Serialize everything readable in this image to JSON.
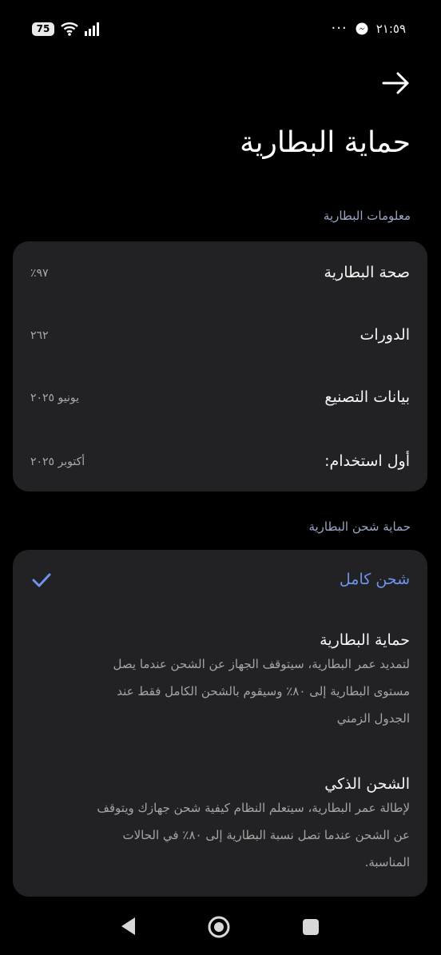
{
  "status_bar": {
    "battery": "75",
    "time": "٢١:٥٩"
  },
  "header": {
    "title": "حماية البطارية"
  },
  "battery_info": {
    "section_label": "معلومات البطارية",
    "rows": [
      {
        "label": "صحة البطارية",
        "value": "٩٧٪"
      },
      {
        "label": "الدورات",
        "value": "٢٦٢"
      },
      {
        "label": "بيانات التصنيع",
        "value": "يونيو ٢٠٢٥"
      },
      {
        "label": "أول استخدام:",
        "value": "أكتوبر ٢٠٢٥"
      }
    ]
  },
  "charging_protection": {
    "section_label": "حماية شحن البطارية",
    "options": [
      {
        "title": "شحن كامل",
        "selected": true
      },
      {
        "title": "حماية البطارية",
        "lines": [
          "لتمديد عمر البطارية، سيتوقف الجهاز عن الشحن عندما يصل",
          "مستوى البطارية إلى ٨٠٪ وسيقوم بالشحن الكامل فقط عند",
          "الجدول الزمني"
        ]
      },
      {
        "title": "الشحن الذكي",
        "lines": [
          "لإطالة عمر البطارية، سيتعلم النظام كيفية شحن جهازك ويتوقف",
          "عن الشحن عندما تصل نسبة البطارية إلى ٨٠٪ في الحالات",
          "المناسبة."
        ]
      }
    ]
  },
  "colors": {
    "accent": "#6e93ea",
    "card": "#222224",
    "section_label": "#9aa6c4"
  },
  "icons": [
    "wifi-icon",
    "signal-icon",
    "messenger-icon",
    "more-icon",
    "back-arrow-icon",
    "check-icon",
    "nav-back-icon",
    "nav-home-icon",
    "nav-recents-icon"
  ]
}
